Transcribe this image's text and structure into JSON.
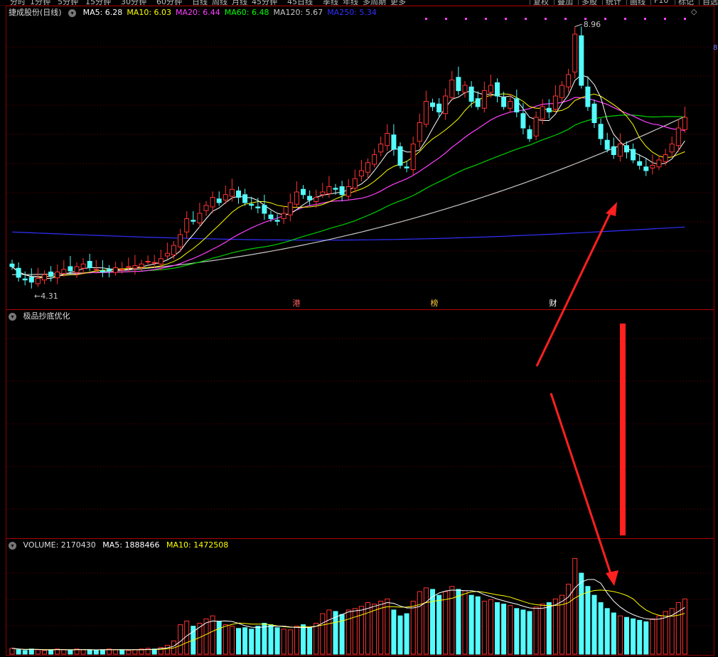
{
  "toolbar": {
    "periods": [
      "分时",
      "1分钟",
      "5分钟",
      "15分钟",
      "30分钟",
      "60分钟",
      "日线",
      "周线",
      "月线",
      "45分钟",
      "45日线",
      "季线",
      "年线",
      "多周期",
      "更多"
    ],
    "right_buttons": [
      "复权",
      "叠加",
      "多股",
      "统计",
      "画线",
      "F10",
      "标记",
      "自选"
    ]
  },
  "main_panel": {
    "stock_title": "捷成股份(日线)",
    "ma_legend": [
      {
        "label": "MA5: 6.28",
        "color": "#ffffff"
      },
      {
        "label": "MA10: 6.03",
        "color": "#ffff00"
      },
      {
        "label": "MA20: 6.44",
        "color": "#ff40ff"
      },
      {
        "label": "MA60: 6.48",
        "color": "#00ff00"
      },
      {
        "label": "MA120: 5.67",
        "color": "#c8c8c8"
      },
      {
        "label": "MA250: 5.34",
        "color": "#3030ff"
      }
    ],
    "high_label": "8.96",
    "low_label": "4.31",
    "events": [
      "港",
      "榜",
      "财"
    ],
    "right_marker": "8"
  },
  "indicator_panel": {
    "title": "极品抄底优化"
  },
  "volume_panel": {
    "title": "VOLUME: 2170430",
    "ma5_label": "MA5: 1888466",
    "ma10_label": "MA10: 1472508"
  },
  "colors": {
    "up": "#ff3232",
    "down": "#54fcfc",
    "grid": "#8a0000",
    "arrow": "#ff2020"
  },
  "chart_data": {
    "type": "candlestick",
    "closes": [
      4.6,
      4.4,
      4.35,
      4.31,
      4.38,
      4.45,
      4.42,
      4.5,
      4.55,
      4.52,
      4.6,
      4.65,
      4.58,
      4.55,
      4.5,
      4.52,
      4.58,
      4.55,
      4.6,
      4.62,
      4.65,
      4.7,
      4.68,
      4.75,
      4.85,
      5.0,
      5.2,
      5.5,
      5.45,
      5.6,
      5.75,
      5.9,
      5.8,
      5.95,
      6.05,
      5.9,
      5.8,
      5.75,
      5.7,
      5.6,
      5.5,
      5.45,
      5.6,
      5.8,
      6.0,
      5.95,
      5.85,
      5.9,
      6.0,
      6.1,
      6.05,
      5.95,
      6.1,
      6.25,
      6.4,
      6.55,
      6.7,
      6.9,
      7.1,
      6.8,
      6.5,
      6.45,
      6.9,
      7.3,
      7.7,
      7.6,
      7.5,
      7.8,
      8.1,
      7.9,
      8.0,
      7.7,
      7.6,
      7.9,
      8.0,
      7.8,
      7.6,
      7.7,
      7.5,
      7.2,
      7.0,
      7.4,
      7.6,
      7.5,
      7.8,
      8.0,
      8.2,
      8.96,
      8.0,
      7.6,
      7.3,
      7.0,
      6.8,
      6.7,
      6.9,
      6.75,
      6.6,
      6.5,
      6.4,
      6.5,
      6.6,
      6.7,
      6.9,
      7.2,
      7.4
    ],
    "volumes": [
      8,
      6,
      5,
      7,
      6,
      5,
      6,
      7,
      6,
      5,
      7,
      6,
      6,
      5,
      6,
      7,
      6,
      6,
      5,
      6,
      7,
      8,
      7,
      9,
      12,
      18,
      40,
      45,
      38,
      42,
      48,
      52,
      44,
      40,
      38,
      35,
      36,
      34,
      38,
      42,
      40,
      36,
      34,
      33,
      38,
      40,
      36,
      42,
      55,
      60,
      58,
      54,
      60,
      62,
      65,
      70,
      68,
      72,
      75,
      60,
      52,
      55,
      72,
      85,
      90,
      88,
      80,
      85,
      92,
      88,
      86,
      80,
      78,
      72,
      74,
      70,
      68,
      66,
      62,
      60,
      58,
      64,
      68,
      70,
      75,
      80,
      95,
      130,
      110,
      92,
      80,
      70,
      62,
      56,
      52,
      50,
      48,
      46,
      44,
      48,
      52,
      58,
      62,
      70,
      75
    ]
  }
}
